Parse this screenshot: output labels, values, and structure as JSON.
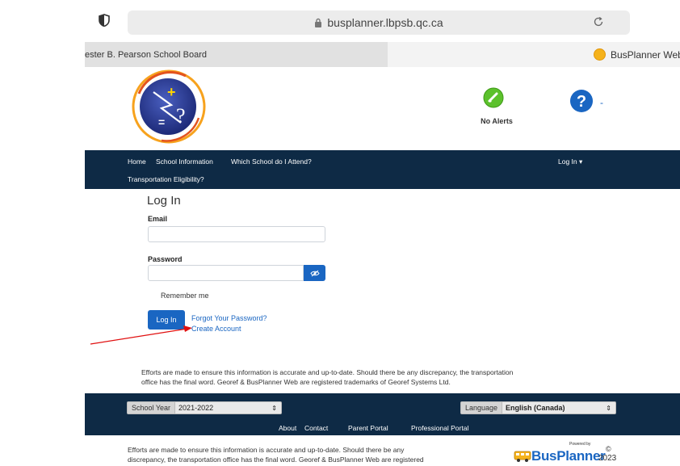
{
  "browser": {
    "url": "busplanner.lbpsb.qc.ca",
    "tabs": [
      {
        "label": "ester B. Pearson School Board"
      },
      {
        "label": "BusPlanner Web"
      }
    ]
  },
  "header": {
    "alert_label": "No Alerts",
    "help_suffix": "-"
  },
  "nav": {
    "items": [
      "Home",
      "School Information",
      "Which School do I Attend?",
      "Transportation Eligibility?"
    ],
    "login": "Log In ▾"
  },
  "login_form": {
    "title": "Log In",
    "email_label": "Email",
    "email_value": "",
    "password_label": "Password",
    "password_value": "",
    "remember_label": "Remember me",
    "submit_label": "Log In",
    "forgot_link": "Forgot Your Password?",
    "create_link": "Create Account"
  },
  "disclaimer": {
    "line1": "Efforts are made to ensure this information is accurate and up-to-date. Should there be any discrepancy, the transportation",
    "line2": "office has the final word. Georef & BusPlanner Web are registered trademarks of Georef Systems Ltd."
  },
  "footer": {
    "school_year_label": "School Year",
    "school_year_value": "2021-2022",
    "language_label": "Language",
    "language_value": "English (Canada)",
    "links": [
      "About",
      "Contact",
      "Parent Portal",
      "Professional Portal"
    ]
  },
  "bottom_notice": {
    "line1": "Efforts are made to ensure this information is accurate and up-to-date. Should there be any",
    "line2": "discrepancy, the transportation office has the final word. Georef & BusPlanner Web are registered"
  },
  "branding": {
    "powered_by": "Powered by",
    "brand": "BusPlanner",
    "copyright": "©",
    "year": "2023"
  },
  "colors": {
    "nav_bg": "#0e2a45",
    "accent": "#1a66c2",
    "alert_green": "#5cc12c"
  }
}
